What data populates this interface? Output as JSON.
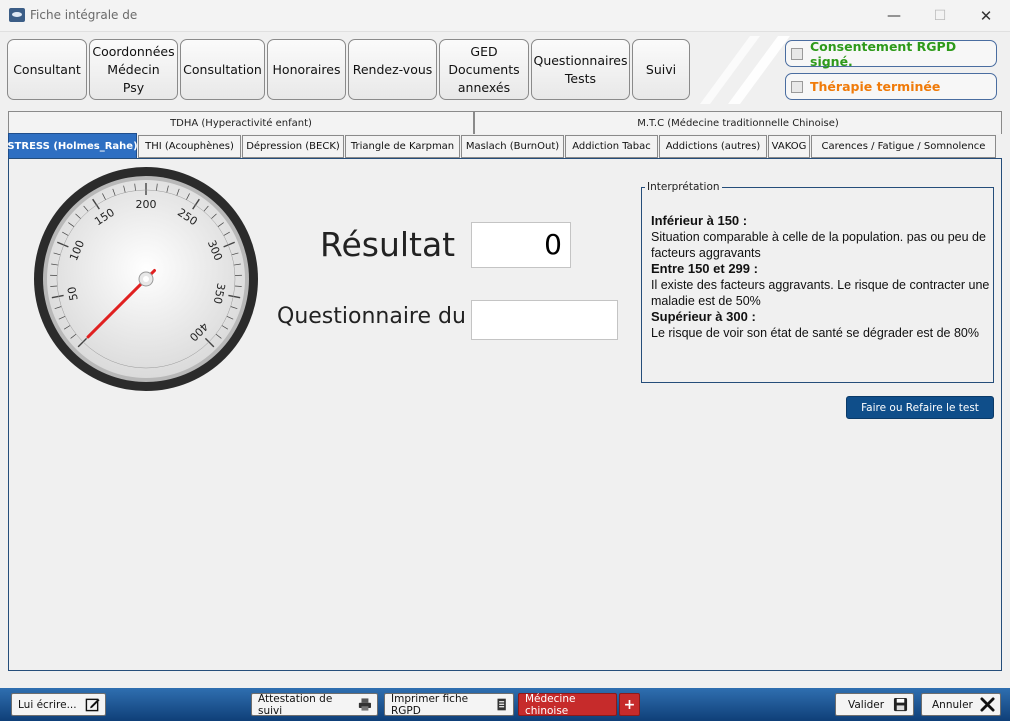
{
  "window": {
    "title": "Fiche intégrale de",
    "min": "—",
    "max": "☐",
    "close": "✕"
  },
  "top_buttons": [
    "Consultant",
    "Coordonnées\nMédecin\nPsy",
    "Consultation",
    "Honoraires",
    "Rendez-vous",
    "GED\nDocuments\nannexés",
    "Questionnaires\nTests",
    "Suivi"
  ],
  "checks": {
    "rgpd": {
      "label": "Consentement RGPD signé.",
      "color": "#2e9a1a",
      "checked": false
    },
    "therapie": {
      "label": "Thérapie terminée",
      "color": "#f07b0a",
      "checked": false
    }
  },
  "tabs_row1": [
    "TDHA (Hyperactivité enfant)",
    "M.T.C (Médecine traditionnelle Chinoise)"
  ],
  "tabs_row2": [
    "STRESS (Holmes_Rahe)",
    "THI (Acouphènes)",
    "Dépression (BECK)",
    "Triangle de Karpman",
    "Maslach (BurnOut)",
    "Addiction Tabac",
    "Addictions (autres)",
    "VAKOG",
    "Carences / Fatigue / Somnolence"
  ],
  "gauge": {
    "ticks": [
      "50",
      "100",
      "150",
      "200",
      "250",
      "300",
      "350",
      "400"
    ],
    "min": 0,
    "max": 400,
    "needle_value": 0
  },
  "result": {
    "label": "Résultat",
    "value": "0"
  },
  "questionnaire": {
    "label": "Questionnaire du",
    "value": ""
  },
  "interpretation": {
    "legend": "Interprétation",
    "h1": "Inférieur à 150 :",
    "t1": "Situation comparable à celle de la population. pas ou peu de facteurs aggravants",
    "h2": "Entre 150 et 299 :",
    "t2": "Il existe des facteurs aggravants. Le risque de contracter une maladie est de 50%",
    "h3": "Supérieur à 300 :",
    "t3": "Le risque de voir son état de santé se dégrader est de 80%"
  },
  "test_button": "Faire ou Refaire le test",
  "bottom": {
    "write": "Lui écrire...",
    "attestation": "Attestation de suivi",
    "imprimer": "Imprimer fiche RGPD",
    "chinoise": "Médecine chinoise",
    "plus": "+",
    "valider": "Valider",
    "annuler": "Annuler"
  }
}
